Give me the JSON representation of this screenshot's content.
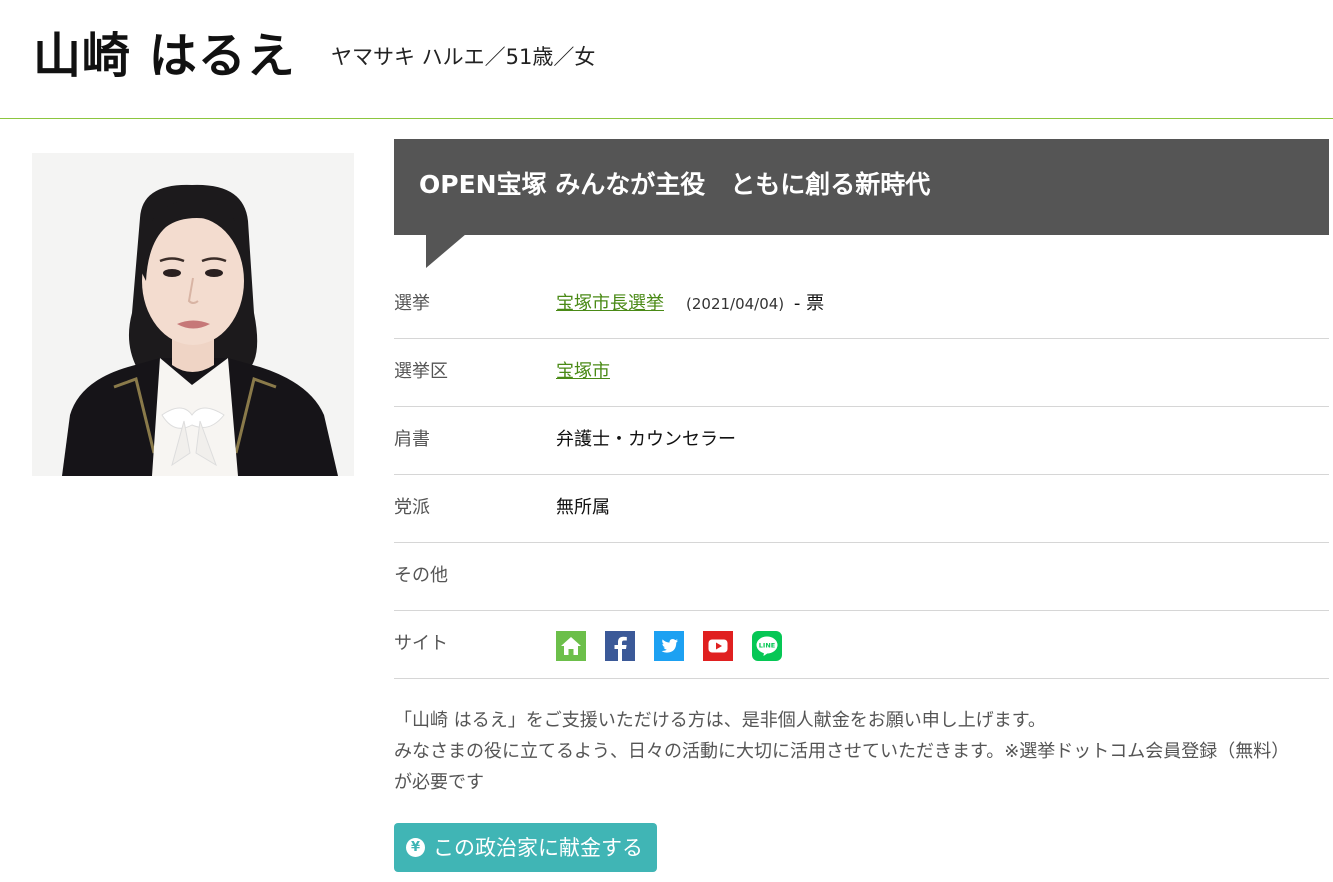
{
  "header": {
    "name": "山崎 はるえ",
    "kana_age_gender": "ヤマサキ ハルエ／51歳／女"
  },
  "slogan": "OPEN宝塚 みんなが主役　ともに創る新時代",
  "info": {
    "election": {
      "label": "選挙",
      "link": "宝塚市長選挙",
      "date": "(2021/04/04)",
      "votes": "- 票"
    },
    "district": {
      "label": "選挙区",
      "link": "宝塚市"
    },
    "title": {
      "label": "肩書",
      "value": "弁護士・カウンセラー"
    },
    "party": {
      "label": "党派",
      "value": "無所属"
    },
    "other": {
      "label": "その他",
      "value": ""
    },
    "site": {
      "label": "サイト",
      "icons": [
        "home-icon",
        "facebook-icon",
        "twitter-icon",
        "youtube-icon",
        "line-icon"
      ],
      "line_text": "LINE"
    }
  },
  "note": {
    "line1": "「山崎 はるえ」をご支援いただける方は、是非個人献金をお願い申し上げます。",
    "line2": "みなさまの役に立てるよう、日々の活動に大切に活用させていただきます。※選挙ドットコム会員登録（無料）が必要です"
  },
  "donate": {
    "yen": "¥",
    "label": "この政治家に献金する"
  },
  "colors": {
    "accent_green": "#8cc63f",
    "link_green": "#4a8a16",
    "slogan_bg": "#555555",
    "donate_teal": "#40b5b5",
    "home_icon": "#6cbf4a",
    "facebook_icon": "#3b5998",
    "twitter_icon": "#1da1f2",
    "youtube_icon": "#e02020",
    "line_icon": "#06c755"
  }
}
